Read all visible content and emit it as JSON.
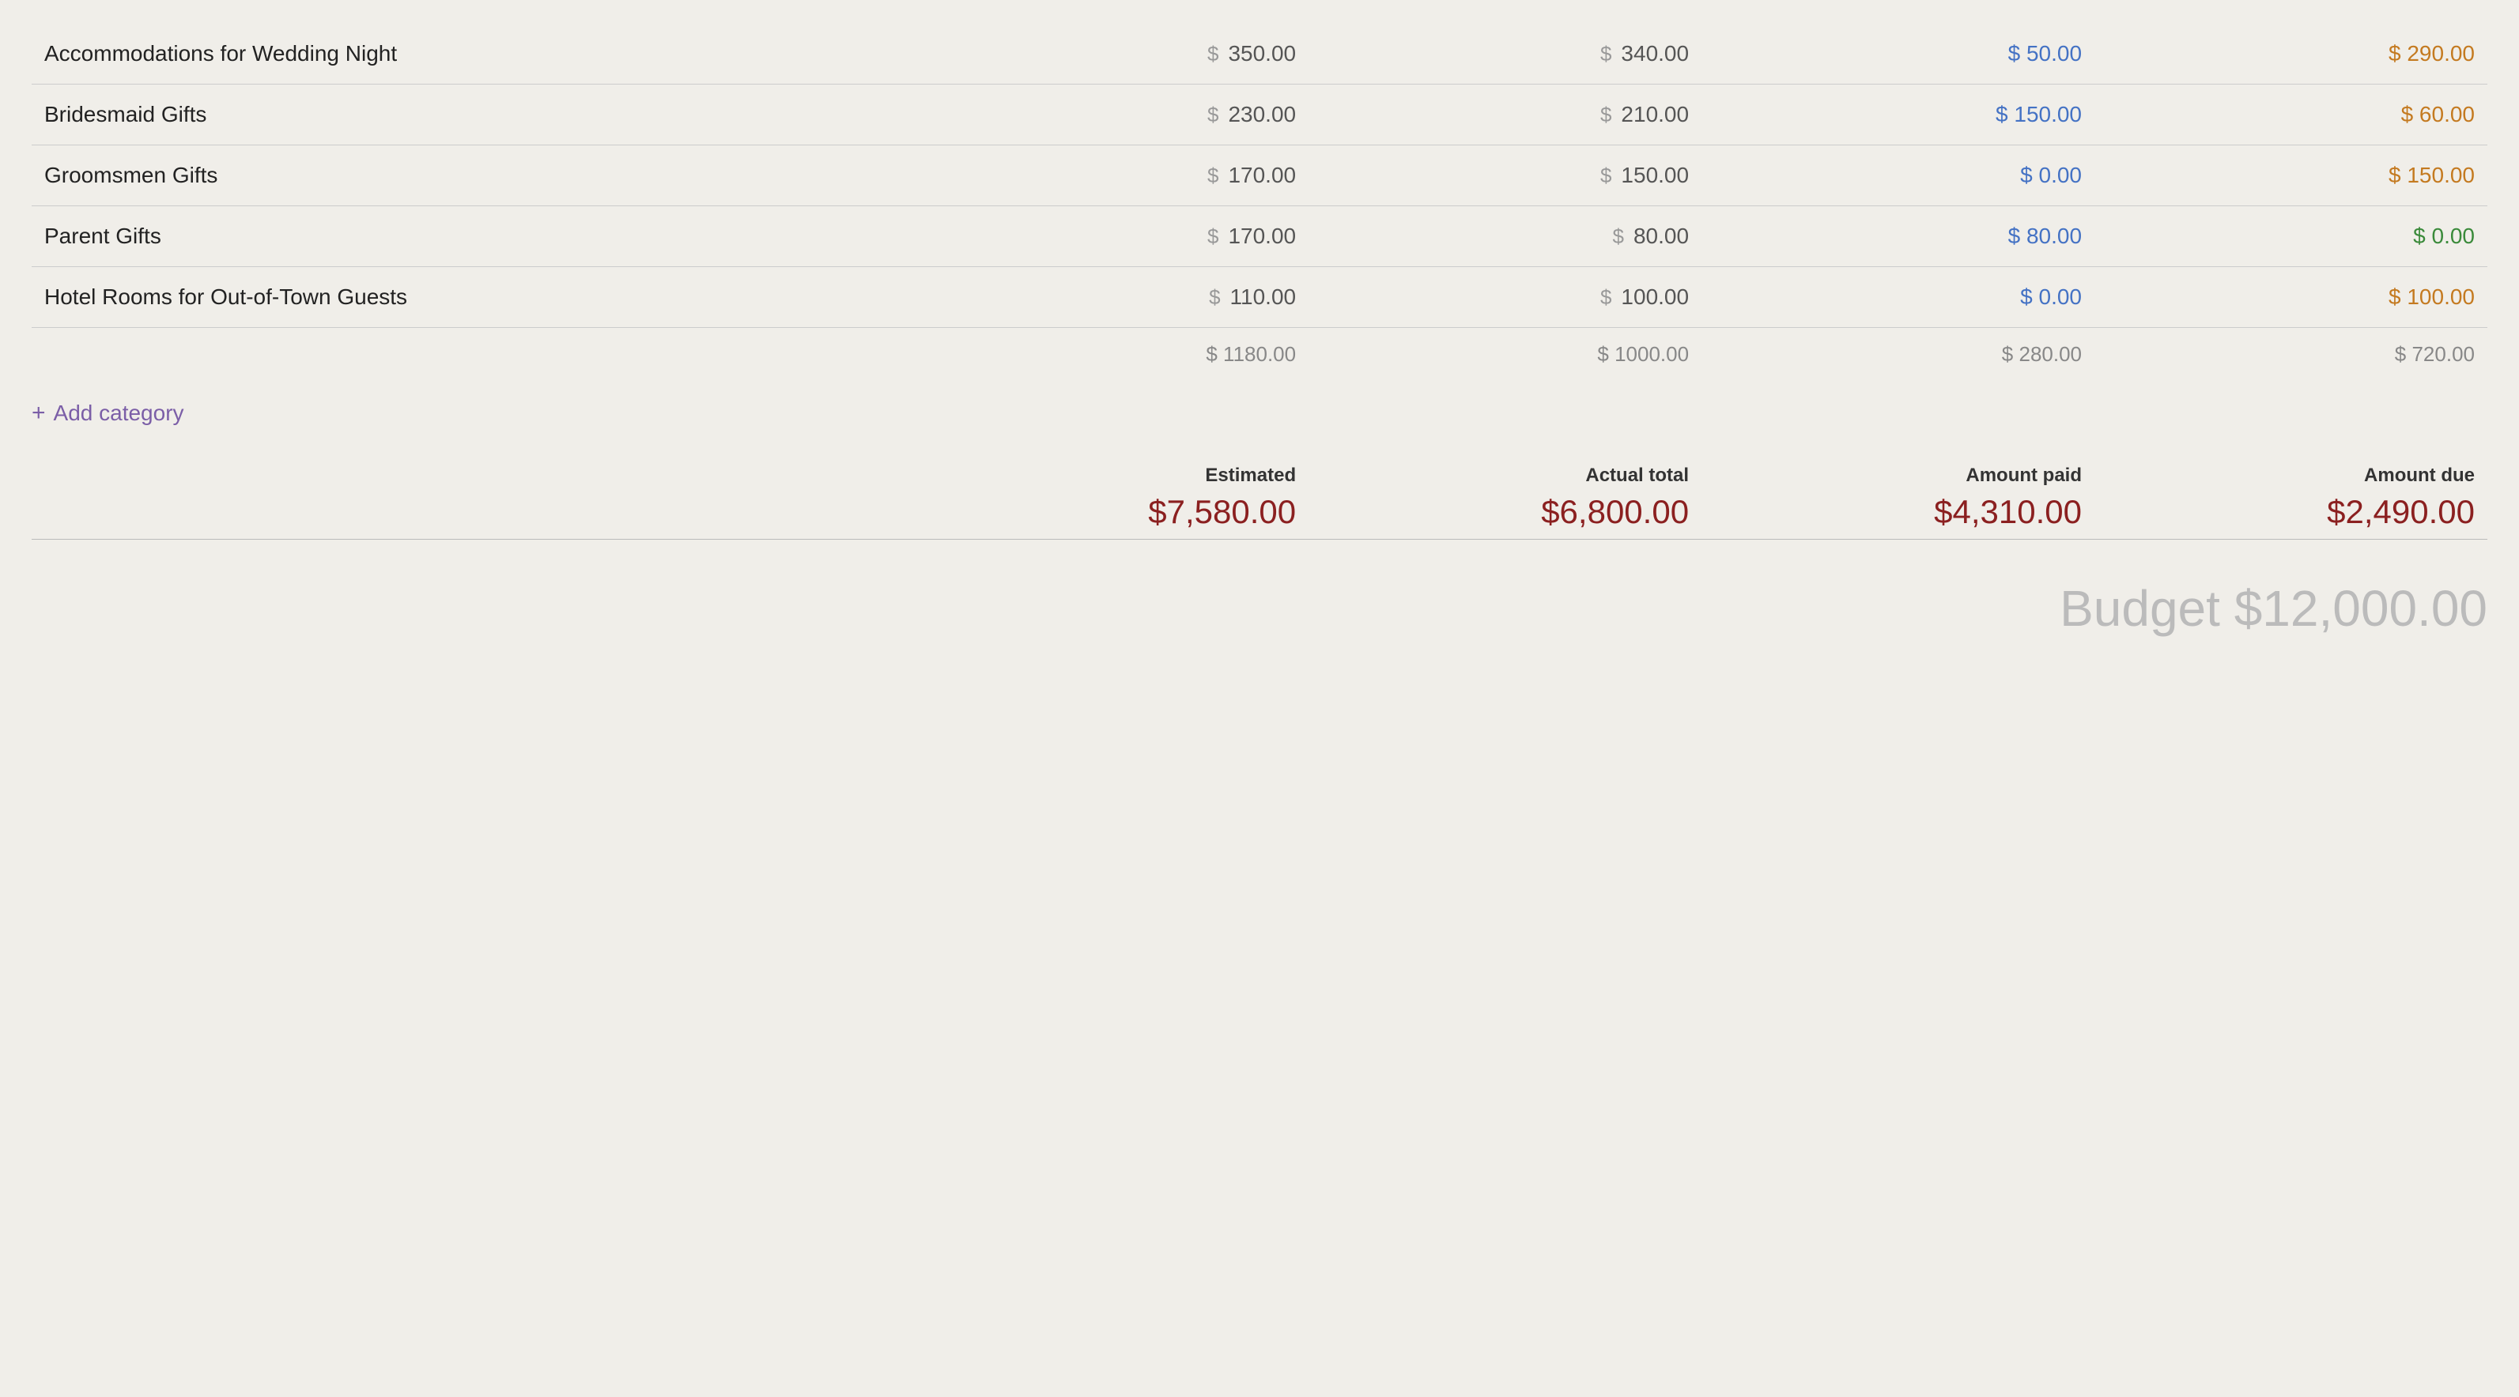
{
  "colors": {
    "blue": "#4472c4",
    "orange": "#c47a20",
    "green": "#3a8a3a",
    "purple": "#7b5ea7",
    "red": "#8b2020",
    "gray": "#999",
    "budget_gray": "#bbb"
  },
  "rows": [
    {
      "name": "Accommodations for Wedding Night",
      "estimated": "350.00",
      "actual": "340.00",
      "paid": "50.00",
      "paid_color": "blue",
      "due": "290.00",
      "due_color": "orange"
    },
    {
      "name": "Bridesmaid Gifts",
      "estimated": "230.00",
      "actual": "210.00",
      "paid": "150.00",
      "paid_color": "blue",
      "due": "60.00",
      "due_color": "orange"
    },
    {
      "name": "Groomsmen Gifts",
      "estimated": "170.00",
      "actual": "150.00",
      "paid": "0.00",
      "paid_color": "blue",
      "due": "150.00",
      "due_color": "orange"
    },
    {
      "name": "Parent Gifts",
      "estimated": "170.00",
      "actual": "80.00",
      "paid": "80.00",
      "paid_color": "blue",
      "due": "0.00",
      "due_color": "green"
    },
    {
      "name": "Hotel Rooms for Out-of-Town Guests",
      "estimated": "110.00",
      "actual": "100.00",
      "paid": "0.00",
      "paid_color": "blue",
      "due": "100.00",
      "due_color": "orange"
    }
  ],
  "subtotals": {
    "estimated": "$ 1180.00",
    "actual": "$ 1000.00",
    "paid": "$ 280.00",
    "due": "$ 720.00"
  },
  "add_category_label": "Add category",
  "summary": {
    "headers": {
      "estimated": "Estimated",
      "actual": "Actual total",
      "paid": "Amount paid",
      "due": "Amount due"
    },
    "values": {
      "estimated": "$7,580.00",
      "actual": "$6,800.00",
      "paid": "$4,310.00",
      "due": "$2,490.00"
    }
  },
  "budget_total_label": "Budget $12,000.00",
  "currency_symbol": "$"
}
